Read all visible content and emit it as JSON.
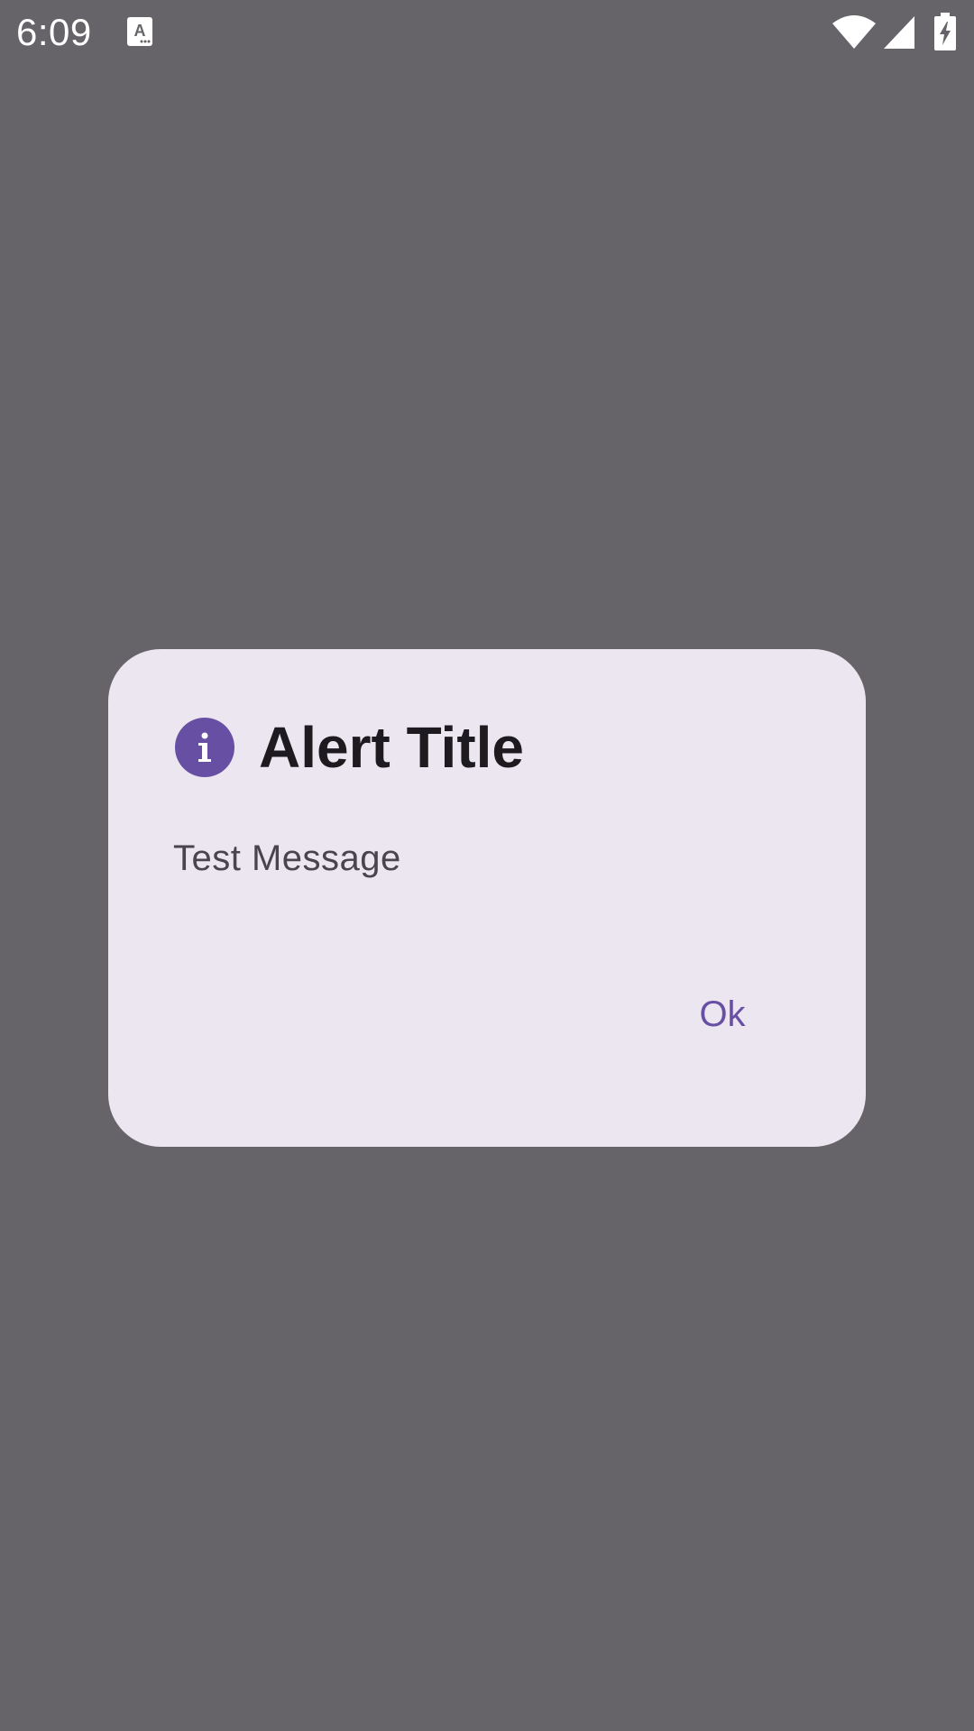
{
  "status_bar": {
    "time": "6:09",
    "notification_icon": "text-a-notification-icon",
    "wifi_icon": "wifi-icon",
    "signal_icon": "cell-signal-icon",
    "battery_icon": "battery-charging-icon"
  },
  "dialog": {
    "icon": "info-icon",
    "icon_glyph": "i",
    "title": "Alert Title",
    "message": "Test Message",
    "confirm_label": "Ok"
  },
  "colors": {
    "scrim": "#666468",
    "surface": "#ece6f0",
    "primary": "#6750a4",
    "on_surface": "#1d1b20",
    "on_surface_variant": "#49454f"
  }
}
